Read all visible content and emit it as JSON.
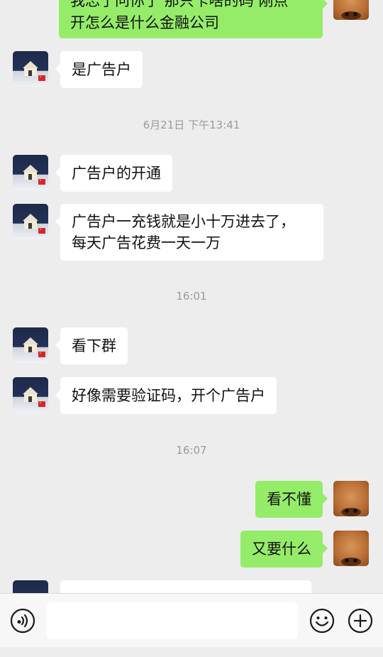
{
  "messages": {
    "m1": "我忘了问你了 那只卡啥的码 刚点\n开怎么是什么金融公司",
    "m2": "是广告户",
    "t1": "6月21日 下午13:41",
    "m3": "广告户的开通",
    "m4_l1": "广告户一充钱就是小十万进去了，",
    "m4_l2": "每天广告花费一天一万",
    "t2": "16:01",
    "m5": "看下群",
    "m6": "好像需要验证码，开个广告户",
    "t3": "16:07",
    "m7": "看不懂",
    "m8": "又要什么"
  },
  "input": {
    "placeholder": ""
  },
  "colors": {
    "my_bubble": "#95ec69",
    "their_bubble": "#ffffff",
    "background": "#ededed"
  },
  "icons": {
    "voice": "voice-icon",
    "emoji": "emoji-icon",
    "more": "plus-icon"
  }
}
